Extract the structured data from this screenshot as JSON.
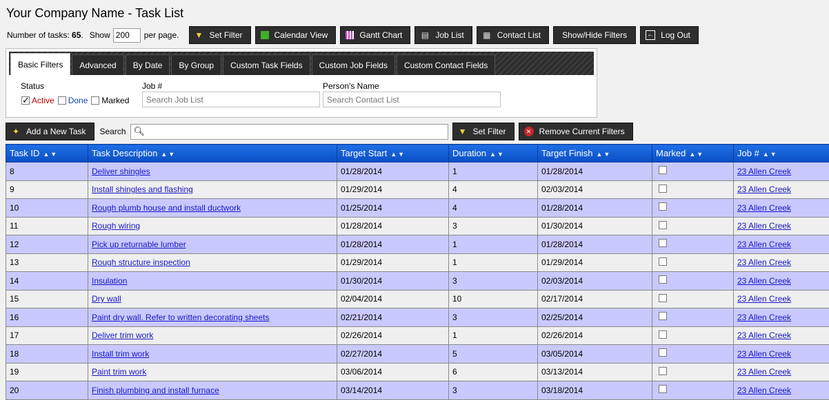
{
  "page": {
    "title": "Your Company Name - Task List"
  },
  "toolbar": {
    "count_label": "Number of tasks:",
    "count_value": "65",
    "count_suffix": ".",
    "show_label": "Show",
    "show_value": "200",
    "per_page_label": "per page.",
    "buttons": {
      "set_filter": "Set Filter",
      "calendar_view": "Calendar View",
      "gantt_chart": "Gantt Chart",
      "job_list": "Job List",
      "contact_list": "Contact List",
      "show_hide_filters": "Show/Hide Filters",
      "log_out": "Log Out"
    }
  },
  "filters": {
    "tabs": [
      "Basic Filters",
      "Advanced",
      "By Date",
      "By Group",
      "Custom Task Fields",
      "Custom Job Fields",
      "Custom Contact Fields"
    ],
    "status_label": "Status",
    "status_active": "Active",
    "status_done": "Done",
    "status_marked": "Marked",
    "job_label": "Job #",
    "job_placeholder": "Search Job List",
    "person_label": "Person's Name",
    "person_placeholder": "Search Contact List"
  },
  "actions": {
    "add_task": "Add a New Task",
    "search_label": "Search",
    "set_filter": "Set Filter",
    "remove_filters": "Remove Current Filters"
  },
  "table": {
    "sort_glyph": "▲▼",
    "columns": [
      "Task ID",
      "Task Description",
      "Target Start",
      "Duration",
      "Target Finish",
      "Marked",
      "Job #"
    ],
    "rows": [
      {
        "id": "8",
        "desc": "Deliver shingles",
        "start": "01/28/2014",
        "duration": "1",
        "finish": "01/28/2014",
        "job": "23 Allen Creek"
      },
      {
        "id": "9",
        "desc": "Install shingles and flashing",
        "start": "01/29/2014",
        "duration": "4",
        "finish": "02/03/2014",
        "job": "23 Allen Creek"
      },
      {
        "id": "10",
        "desc": "Rough plumb house and install ductwork",
        "start": "01/25/2014",
        "duration": "4",
        "finish": "01/28/2014",
        "job": "23 Allen Creek"
      },
      {
        "id": "11",
        "desc": "Rough wiring",
        "start": "01/28/2014",
        "duration": "3",
        "finish": "01/30/2014",
        "job": "23 Allen Creek"
      },
      {
        "id": "12",
        "desc": "Pick up returnable lumber",
        "start": "01/28/2014",
        "duration": "1",
        "finish": "01/28/2014",
        "job": "23 Allen Creek"
      },
      {
        "id": "13",
        "desc": "Rough structure inspection",
        "start": "01/29/2014",
        "duration": "1",
        "finish": "01/29/2014",
        "job": "23 Allen Creek"
      },
      {
        "id": "14",
        "desc": "Insulation",
        "start": "01/30/2014",
        "duration": "3",
        "finish": "02/03/2014",
        "job": "23 Allen Creek"
      },
      {
        "id": "15",
        "desc": "Dry wall",
        "start": "02/04/2014",
        "duration": "10",
        "finish": "02/17/2014",
        "job": "23 Allen Creek"
      },
      {
        "id": "16",
        "desc": "Paint dry wall. Refer to written decorating sheets",
        "start": "02/21/2014",
        "duration": "3",
        "finish": "02/25/2014",
        "job": "23 Allen Creek"
      },
      {
        "id": "17",
        "desc": "Deliver trim work",
        "start": "02/26/2014",
        "duration": "1",
        "finish": "02/26/2014",
        "job": "23 Allen Creek"
      },
      {
        "id": "18",
        "desc": "Install trim work",
        "start": "02/27/2014",
        "duration": "5",
        "finish": "03/05/2014",
        "job": "23 Allen Creek"
      },
      {
        "id": "19",
        "desc": "Paint trim work",
        "start": "03/06/2014",
        "duration": "6",
        "finish": "03/13/2014",
        "job": "23 Allen Creek"
      },
      {
        "id": "20",
        "desc": "Finish plumbing and install furnace",
        "start": "03/14/2014",
        "duration": "3",
        "finish": "03/18/2014",
        "job": "23 Allen Creek"
      }
    ]
  },
  "colors": {
    "header_blue": "#0b4fc4",
    "row_odd": "#c9c9ff",
    "row_even": "#efefef",
    "link": "#1717c6",
    "button_dark": "#2e2e2e"
  }
}
